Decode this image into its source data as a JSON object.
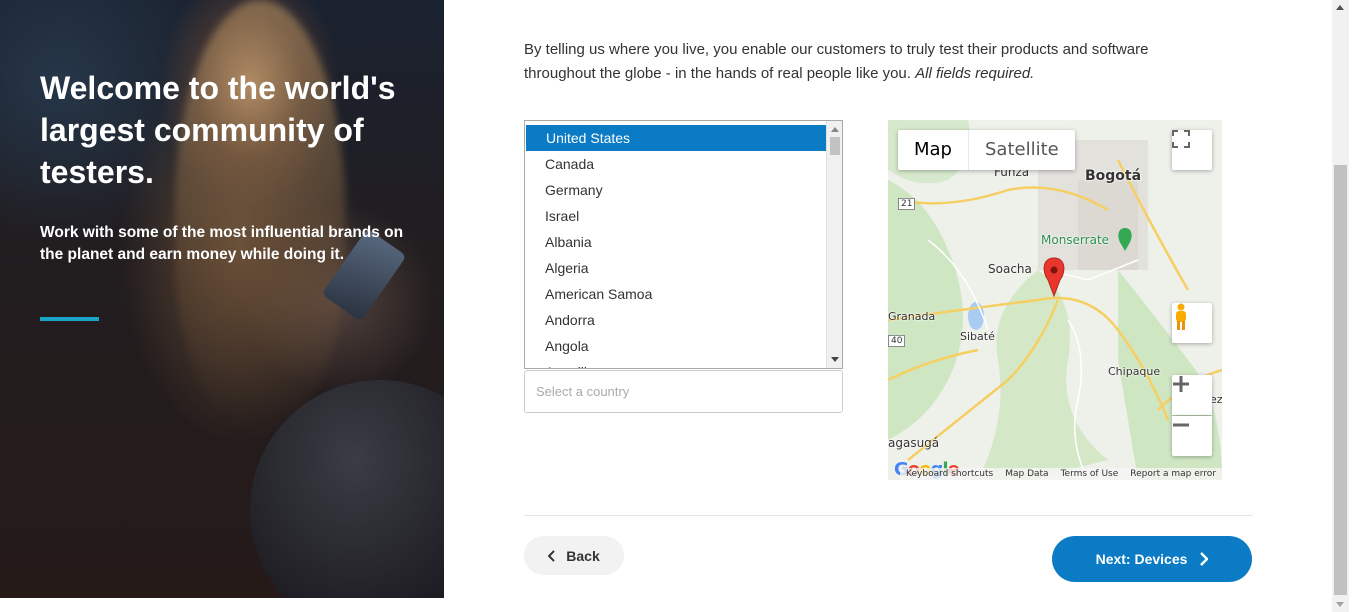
{
  "hero": {
    "title": "Welcome to the world's largest community of testers.",
    "subtitle": "Work with some of the most influential brands on the planet and earn money while doing it."
  },
  "content": {
    "intro_text": "By telling us where you live, you enable our customers to truly test their products and software throughout the globe - in the hands of real people like you.",
    "intro_required": "All fields required.",
    "country_placeholder": "Select a country",
    "country_options": [
      "United States",
      "Canada",
      "Germany",
      "Israel",
      "Albania",
      "Algeria",
      "American Samoa",
      "Andorra",
      "Angola",
      "Anguilla"
    ],
    "selected_option": "United States"
  },
  "map": {
    "type_map": "Map",
    "type_satellite": "Satellite",
    "labels": {
      "bogota": "Bogotá",
      "funza": "Funza",
      "monserrate": "Monserrate",
      "soacha": "Soacha",
      "granada": "Granada",
      "sibate": "Sibaté",
      "chipaque": "Chipaque",
      "fusagasuga": "agasugá",
      "route21": "21",
      "route40": "40",
      "edge_ez": "ez"
    },
    "footer": {
      "keyboard": "Keyboard shortcuts",
      "map_data": "Map Data",
      "terms": "Terms of Use",
      "report": "Report a map error"
    },
    "logo": "Google"
  },
  "buttons": {
    "back": "Back",
    "next": "Next: Devices"
  },
  "colors": {
    "primary": "#0a7bc4",
    "accent_bar": "#1aa3c9"
  }
}
